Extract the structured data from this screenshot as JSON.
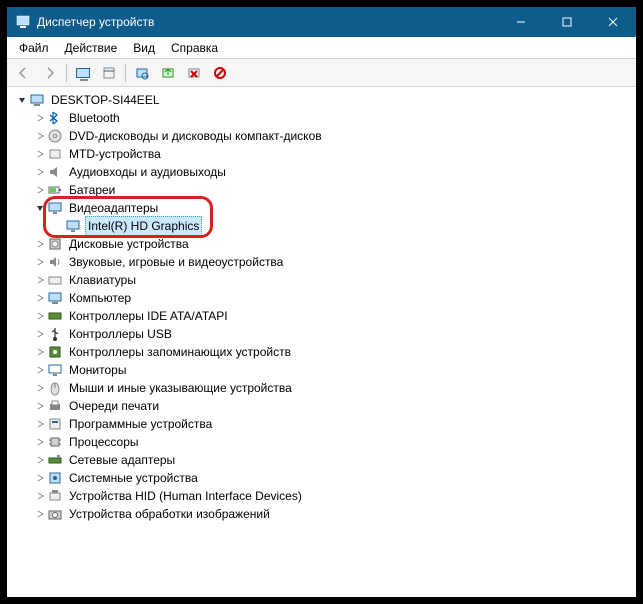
{
  "window": {
    "title": "Диспетчер устройств"
  },
  "menu": {
    "file": "Файл",
    "action": "Действие",
    "view": "Вид",
    "help": "Справка"
  },
  "toolbar_icons": {
    "back": "back",
    "fwd": "forward",
    "monitor": "monitor",
    "prop": "properties",
    "rescan": "scan",
    "update": "update",
    "uninst": "uninstall",
    "en": "enable",
    "dis": "disable"
  },
  "tree": {
    "root": "DESKTOP-SI44EEL",
    "categories": [
      {
        "label": "Bluetooth",
        "icon": "bluetooth"
      },
      {
        "label": "DVD-дисководы и дисководы компакт-дисков",
        "icon": "dvd"
      },
      {
        "label": "MTD-устройства",
        "icon": "generic"
      },
      {
        "label": "Аудиовходы и аудиовыходы",
        "icon": "speaker"
      },
      {
        "label": "Батареи",
        "icon": "battery"
      },
      {
        "label": "Видеоадаптеры",
        "icon": "display",
        "expanded": true,
        "children": [
          {
            "label": "Intel(R) HD Graphics",
            "icon": "display",
            "selected": true
          }
        ]
      },
      {
        "label": "Дисковые устройства",
        "icon": "disk"
      },
      {
        "label": "Звуковые, игровые и видеоустройства",
        "icon": "audio"
      },
      {
        "label": "Клавиатуры",
        "icon": "keyboard"
      },
      {
        "label": "Компьютер",
        "icon": "computer"
      },
      {
        "label": "Контроллеры IDE ATA/ATAPI",
        "icon": "ide"
      },
      {
        "label": "Контроллеры USB",
        "icon": "usb"
      },
      {
        "label": "Контроллеры запоминающих устройств",
        "icon": "storage"
      },
      {
        "label": "Мониторы",
        "icon": "monitor"
      },
      {
        "label": "Мыши и иные указывающие устройства",
        "icon": "mouse"
      },
      {
        "label": "Очереди печати",
        "icon": "printer"
      },
      {
        "label": "Программные устройства",
        "icon": "sw"
      },
      {
        "label": "Процессоры",
        "icon": "cpu"
      },
      {
        "label": "Сетевые адаптеры",
        "icon": "net"
      },
      {
        "label": "Системные устройства",
        "icon": "system"
      },
      {
        "label": "Устройства HID (Human Interface Devices)",
        "icon": "hid"
      },
      {
        "label": "Устройства обработки изображений",
        "icon": "imaging"
      }
    ]
  },
  "highlight": {
    "label_path": "tree.categories.5.label"
  }
}
